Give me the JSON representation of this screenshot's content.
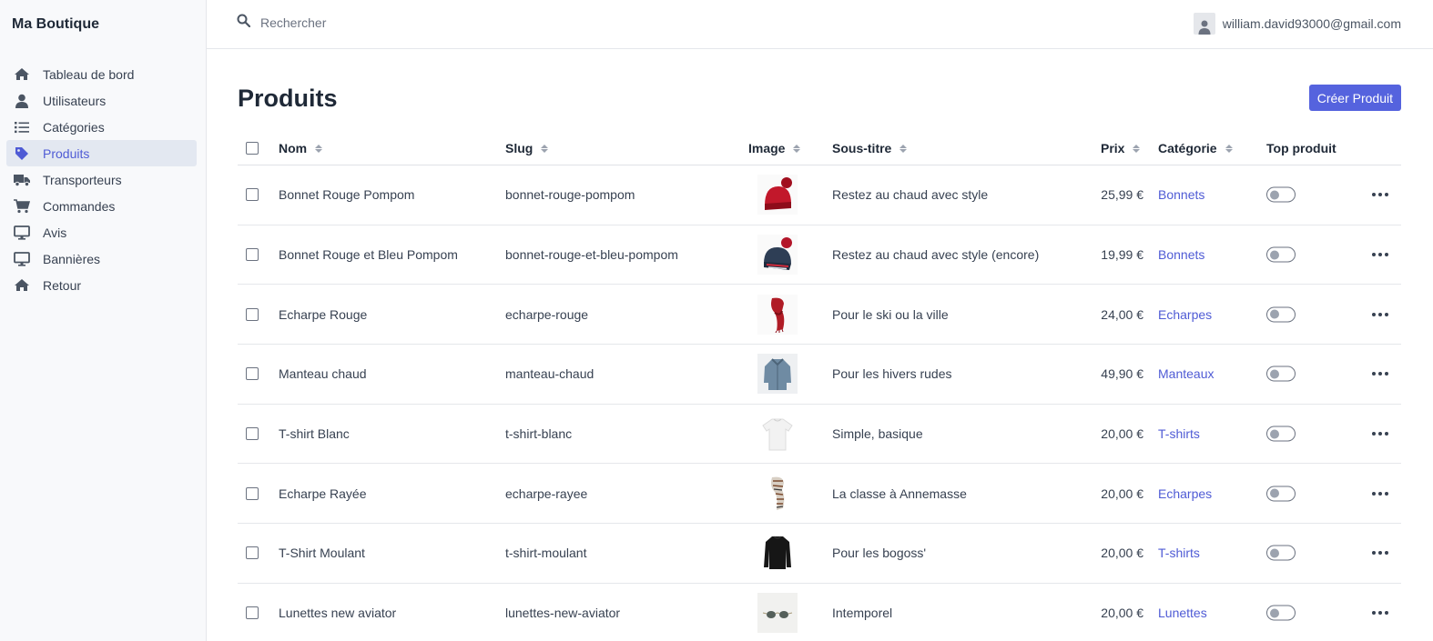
{
  "brand": "Ma Boutique",
  "sidebar": {
    "items": [
      {
        "label": "Tableau de bord",
        "icon": "home-icon"
      },
      {
        "label": "Utilisateurs",
        "icon": "user-icon"
      },
      {
        "label": "Catégories",
        "icon": "list-icon"
      },
      {
        "label": "Produits",
        "icon": "tag-icon",
        "active": true
      },
      {
        "label": "Transporteurs",
        "icon": "truck-icon"
      },
      {
        "label": "Commandes",
        "icon": "cart-icon"
      },
      {
        "label": "Avis",
        "icon": "monitor-icon"
      },
      {
        "label": "Bannières",
        "icon": "monitor-icon"
      },
      {
        "label": "Retour",
        "icon": "home-icon"
      }
    ]
  },
  "topbar": {
    "search_placeholder": "Rechercher",
    "user_email": "william.david93000@gmail.com"
  },
  "page": {
    "title": "Produits",
    "create_button": "Créer Produit"
  },
  "table": {
    "headers": {
      "name": "Nom",
      "slug": "Slug",
      "image": "Image",
      "subtitle": "Sous-titre",
      "price": "Prix",
      "category": "Catégorie",
      "top": "Top produit"
    },
    "rows": [
      {
        "name": "Bonnet Rouge Pompom",
        "slug": "bonnet-rouge-pompom",
        "image": "red-beanie",
        "subtitle": "Restez au chaud avec style",
        "price": "25,99 €",
        "category": "Bonnets",
        "top": false
      },
      {
        "name": "Bonnet Rouge et Bleu Pompom",
        "slug": "bonnet-rouge-et-bleu-pompom",
        "image": "blue-red-beanie",
        "subtitle": "Restez au chaud avec style (encore)",
        "price": "19,99 €",
        "category": "Bonnets",
        "top": false
      },
      {
        "name": "Echarpe Rouge",
        "slug": "echarpe-rouge",
        "image": "red-scarf",
        "subtitle": "Pour le ski ou la ville",
        "price": "24,00 €",
        "category": "Echarpes",
        "top": false
      },
      {
        "name": "Manteau chaud",
        "slug": "manteau-chaud",
        "image": "coat",
        "subtitle": "Pour les hivers rudes",
        "price": "49,90 €",
        "category": "Manteaux",
        "top": false
      },
      {
        "name": "T-shirt Blanc",
        "slug": "t-shirt-blanc",
        "image": "white-tshirt",
        "subtitle": "Simple, basique",
        "price": "20,00 €",
        "category": "T-shirts",
        "top": false
      },
      {
        "name": "Echarpe Rayée",
        "slug": "echarpe-rayee",
        "image": "striped-scarf",
        "subtitle": "La classe à Annemasse",
        "price": "20,00 €",
        "category": "Echarpes",
        "top": false
      },
      {
        "name": "T-Shirt Moulant",
        "slug": "t-shirt-moulant",
        "image": "black-tshirt",
        "subtitle": "Pour les bogoss'",
        "price": "20,00 €",
        "category": "T-shirts",
        "top": false
      },
      {
        "name": "Lunettes new aviator",
        "slug": "lunettes-new-aviator",
        "image": "sunglasses",
        "subtitle": "Intemporel",
        "price": "20,00 €",
        "category": "Lunettes",
        "top": false
      }
    ]
  },
  "colors": {
    "accent": "#5563de",
    "link": "#4f5bd5",
    "active_bg": "#e3e8f1"
  }
}
